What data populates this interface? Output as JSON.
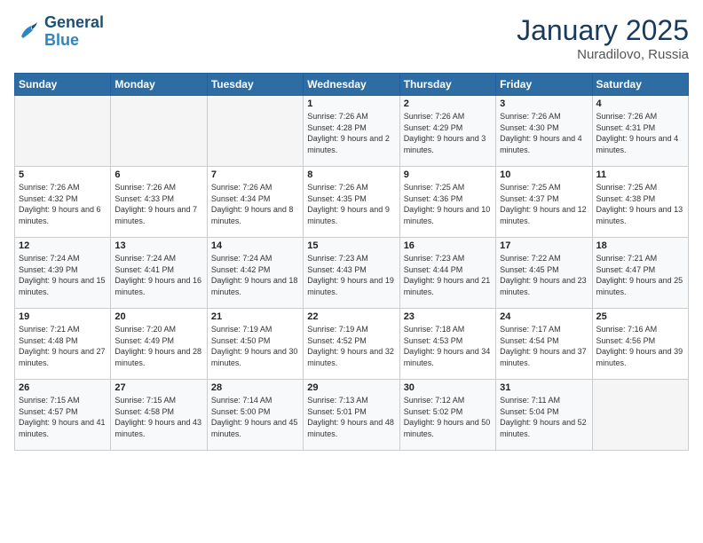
{
  "header": {
    "title": "January 2025",
    "location": "Nuradilovo, Russia"
  },
  "columns": [
    "Sunday",
    "Monday",
    "Tuesday",
    "Wednesday",
    "Thursday",
    "Friday",
    "Saturday"
  ],
  "weeks": [
    [
      {
        "day": "",
        "info": ""
      },
      {
        "day": "",
        "info": ""
      },
      {
        "day": "",
        "info": ""
      },
      {
        "day": "1",
        "info": "Sunrise: 7:26 AM\nSunset: 4:28 PM\nDaylight: 9 hours\nand 2 minutes."
      },
      {
        "day": "2",
        "info": "Sunrise: 7:26 AM\nSunset: 4:29 PM\nDaylight: 9 hours\nand 3 minutes."
      },
      {
        "day": "3",
        "info": "Sunrise: 7:26 AM\nSunset: 4:30 PM\nDaylight: 9 hours\nand 4 minutes."
      },
      {
        "day": "4",
        "info": "Sunrise: 7:26 AM\nSunset: 4:31 PM\nDaylight: 9 hours\nand 4 minutes."
      }
    ],
    [
      {
        "day": "5",
        "info": "Sunrise: 7:26 AM\nSunset: 4:32 PM\nDaylight: 9 hours\nand 6 minutes."
      },
      {
        "day": "6",
        "info": "Sunrise: 7:26 AM\nSunset: 4:33 PM\nDaylight: 9 hours\nand 7 minutes."
      },
      {
        "day": "7",
        "info": "Sunrise: 7:26 AM\nSunset: 4:34 PM\nDaylight: 9 hours\nand 8 minutes."
      },
      {
        "day": "8",
        "info": "Sunrise: 7:26 AM\nSunset: 4:35 PM\nDaylight: 9 hours\nand 9 minutes."
      },
      {
        "day": "9",
        "info": "Sunrise: 7:25 AM\nSunset: 4:36 PM\nDaylight: 9 hours\nand 10 minutes."
      },
      {
        "day": "10",
        "info": "Sunrise: 7:25 AM\nSunset: 4:37 PM\nDaylight: 9 hours\nand 12 minutes."
      },
      {
        "day": "11",
        "info": "Sunrise: 7:25 AM\nSunset: 4:38 PM\nDaylight: 9 hours\nand 13 minutes."
      }
    ],
    [
      {
        "day": "12",
        "info": "Sunrise: 7:24 AM\nSunset: 4:39 PM\nDaylight: 9 hours\nand 15 minutes."
      },
      {
        "day": "13",
        "info": "Sunrise: 7:24 AM\nSunset: 4:41 PM\nDaylight: 9 hours\nand 16 minutes."
      },
      {
        "day": "14",
        "info": "Sunrise: 7:24 AM\nSunset: 4:42 PM\nDaylight: 9 hours\nand 18 minutes."
      },
      {
        "day": "15",
        "info": "Sunrise: 7:23 AM\nSunset: 4:43 PM\nDaylight: 9 hours\nand 19 minutes."
      },
      {
        "day": "16",
        "info": "Sunrise: 7:23 AM\nSunset: 4:44 PM\nDaylight: 9 hours\nand 21 minutes."
      },
      {
        "day": "17",
        "info": "Sunrise: 7:22 AM\nSunset: 4:45 PM\nDaylight: 9 hours\nand 23 minutes."
      },
      {
        "day": "18",
        "info": "Sunrise: 7:21 AM\nSunset: 4:47 PM\nDaylight: 9 hours\nand 25 minutes."
      }
    ],
    [
      {
        "day": "19",
        "info": "Sunrise: 7:21 AM\nSunset: 4:48 PM\nDaylight: 9 hours\nand 27 minutes."
      },
      {
        "day": "20",
        "info": "Sunrise: 7:20 AM\nSunset: 4:49 PM\nDaylight: 9 hours\nand 28 minutes."
      },
      {
        "day": "21",
        "info": "Sunrise: 7:19 AM\nSunset: 4:50 PM\nDaylight: 9 hours\nand 30 minutes."
      },
      {
        "day": "22",
        "info": "Sunrise: 7:19 AM\nSunset: 4:52 PM\nDaylight: 9 hours\nand 32 minutes."
      },
      {
        "day": "23",
        "info": "Sunrise: 7:18 AM\nSunset: 4:53 PM\nDaylight: 9 hours\nand 34 minutes."
      },
      {
        "day": "24",
        "info": "Sunrise: 7:17 AM\nSunset: 4:54 PM\nDaylight: 9 hours\nand 37 minutes."
      },
      {
        "day": "25",
        "info": "Sunrise: 7:16 AM\nSunset: 4:56 PM\nDaylight: 9 hours\nand 39 minutes."
      }
    ],
    [
      {
        "day": "26",
        "info": "Sunrise: 7:15 AM\nSunset: 4:57 PM\nDaylight: 9 hours\nand 41 minutes."
      },
      {
        "day": "27",
        "info": "Sunrise: 7:15 AM\nSunset: 4:58 PM\nDaylight: 9 hours\nand 43 minutes."
      },
      {
        "day": "28",
        "info": "Sunrise: 7:14 AM\nSunset: 5:00 PM\nDaylight: 9 hours\nand 45 minutes."
      },
      {
        "day": "29",
        "info": "Sunrise: 7:13 AM\nSunset: 5:01 PM\nDaylight: 9 hours\nand 48 minutes."
      },
      {
        "day": "30",
        "info": "Sunrise: 7:12 AM\nSunset: 5:02 PM\nDaylight: 9 hours\nand 50 minutes."
      },
      {
        "day": "31",
        "info": "Sunrise: 7:11 AM\nSunset: 5:04 PM\nDaylight: 9 hours\nand 52 minutes."
      },
      {
        "day": "",
        "info": ""
      }
    ]
  ]
}
